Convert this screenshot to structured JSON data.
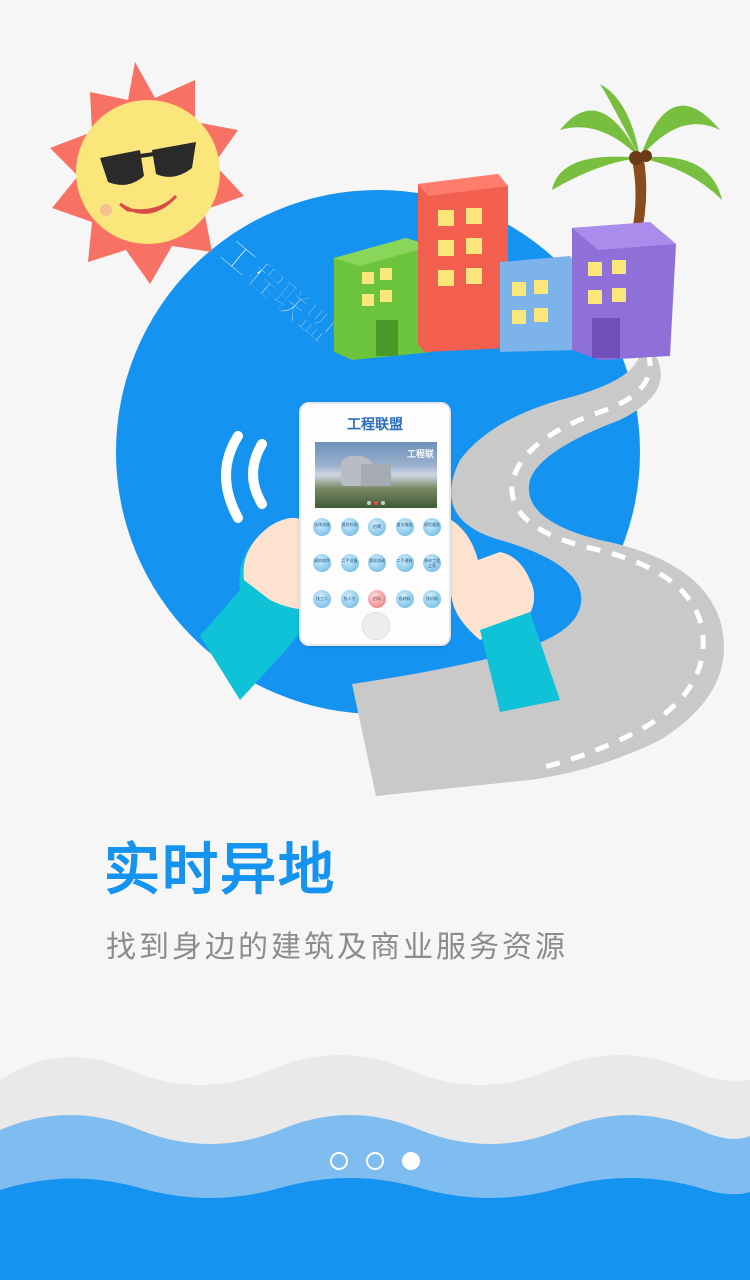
{
  "illustration": {
    "badge_text": "工程联盟",
    "phone": {
      "title": "工程联盟",
      "banner_text": "工程联",
      "grid_rows": [
        [
          "法律咨询",
          "规划检测",
          "招聘",
          "商业服务",
          "保险服务"
        ],
        [
          "建筑软件",
          "二手设备",
          "管理咨询",
          "二手建材",
          "装修工程之家"
        ],
        [
          "找工人",
          "找人才",
          "招标",
          "找材料",
          "找机械"
        ]
      ],
      "highlight_item": "招标"
    }
  },
  "onboarding": {
    "headline": "实时异地",
    "subtitle": "找到身边的建筑及商业服务资源"
  },
  "pager": {
    "total": 3,
    "active_index": 2
  },
  "colors": {
    "brand_blue": "#1593f0",
    "subtitle_gray": "#8c8c8c",
    "background": "#f6f6f6",
    "wave_light": "#7fbdf0",
    "wave_dark": "#1593f0"
  }
}
